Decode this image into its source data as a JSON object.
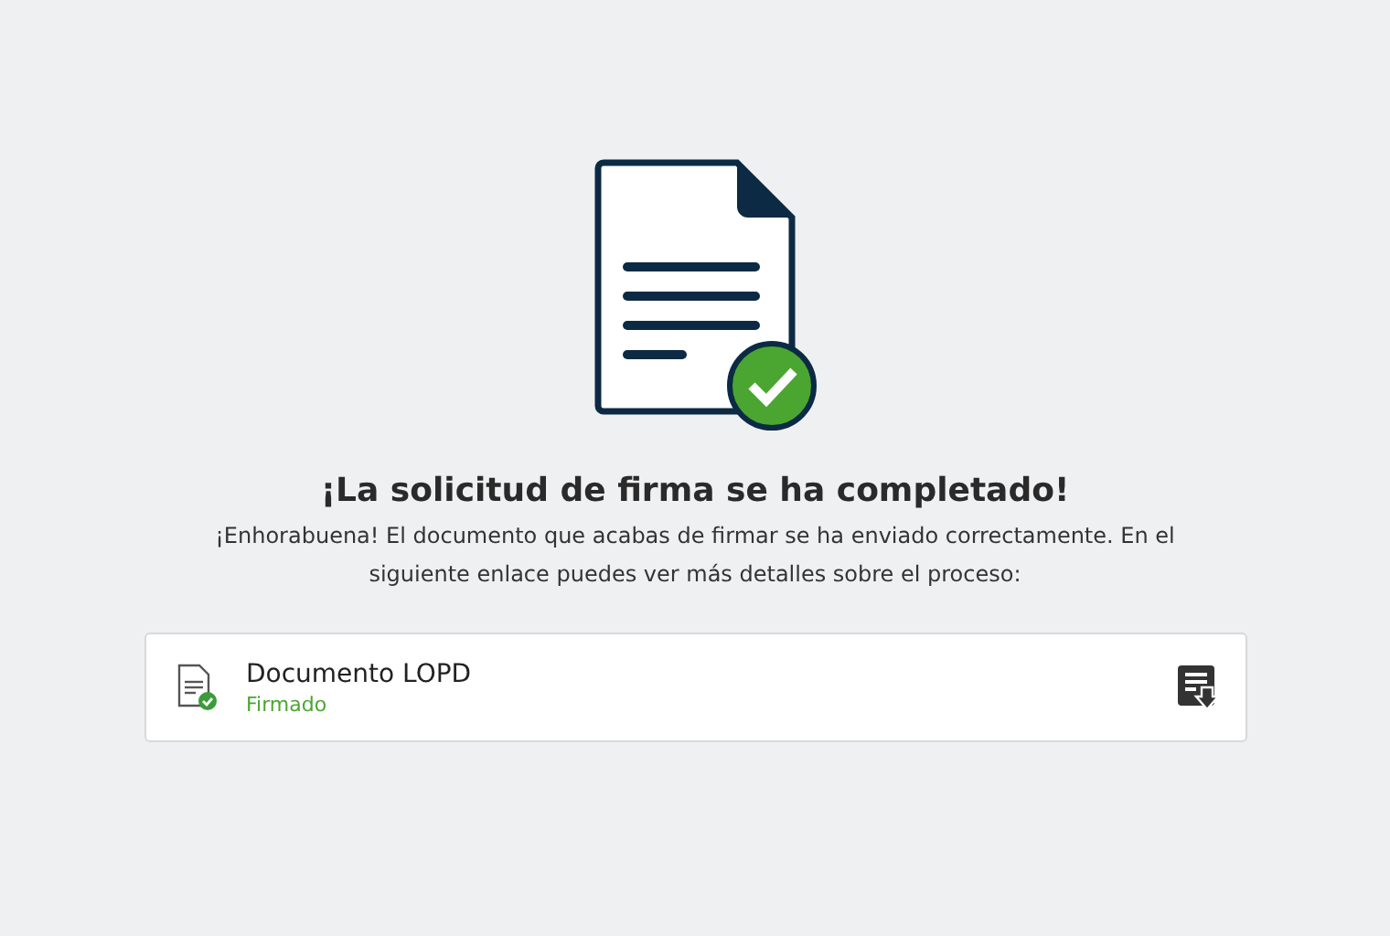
{
  "title": "¡La solicitud de firma se ha completado!",
  "message": "¡Enhorabuena! El documento que acabas de firmar se ha enviado correctamente. En el siguiente enlace puedes ver más detalles sobre el proceso:",
  "document": {
    "name": "Documento LOPD",
    "status": "Firmado"
  }
}
